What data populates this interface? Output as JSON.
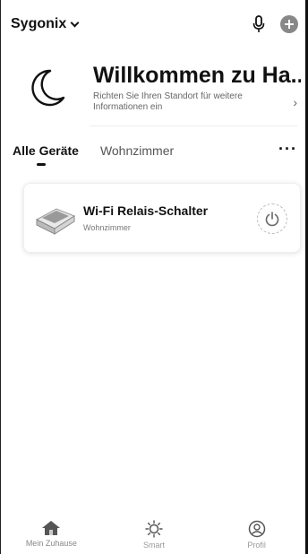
{
  "header": {
    "home_name": "Sygonix",
    "icons": [
      "chevron-down-icon",
      "microphone-icon",
      "add-icon"
    ]
  },
  "welcome": {
    "title": "Willkommen zu Ha...",
    "subtitle": "Richten Sie Ihren Standort für weitere Informationen ein",
    "arrow": "›"
  },
  "tabs": [
    {
      "label": "Alle Geräte",
      "active": true
    },
    {
      "label": "Wohnzimmer",
      "active": false
    }
  ],
  "more_label": "···",
  "devices": [
    {
      "name": "Wi-Fi Relais-Schalter",
      "room": "Wohnzimmer"
    }
  ],
  "bottom_nav": [
    {
      "label": "Mein Zuhause",
      "icon": "home-icon",
      "active": true
    },
    {
      "label": "Smart",
      "icon": "smart-sun-icon",
      "active": false
    },
    {
      "label": "Profil",
      "icon": "profile-icon",
      "active": false
    }
  ]
}
